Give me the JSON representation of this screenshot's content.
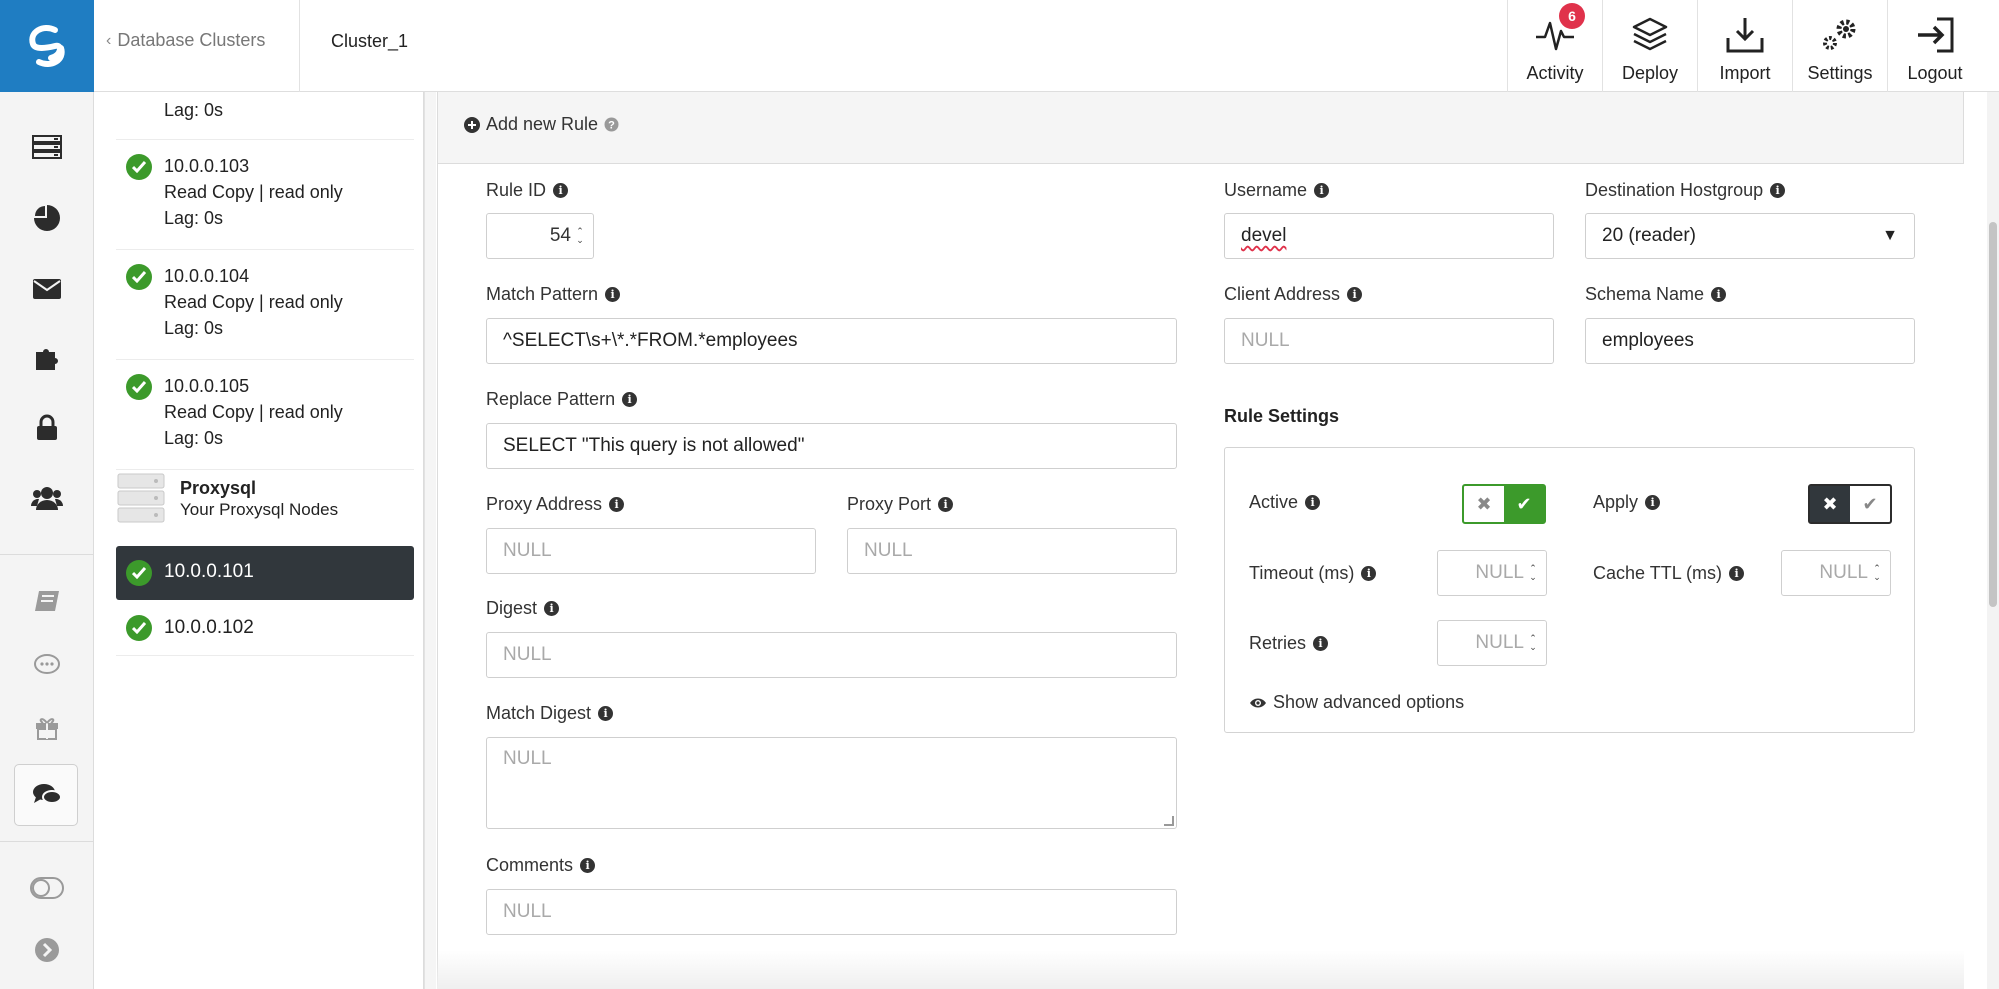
{
  "breadcrumb": {
    "back_label": "Database Clusters",
    "current": "Cluster_1"
  },
  "top_nav": [
    {
      "label": "Activity",
      "icon": "activity-icon",
      "badge": "6"
    },
    {
      "label": "Deploy",
      "icon": "deploy-icon"
    },
    {
      "label": "Import",
      "icon": "import-icon"
    },
    {
      "label": "Settings",
      "icon": "settings-icon"
    },
    {
      "label": "Logout",
      "icon": "logout-icon"
    }
  ],
  "rail_icons": [
    "clusters-icon",
    "dashboards-icon",
    "alarms-icon",
    "integrations-icon",
    "security-icon",
    "users-icon",
    "docs-icon",
    "feedback-icon",
    "whats-new-icon",
    "chat-icon",
    "toggle-icon",
    "expand-icon"
  ],
  "nodes": {
    "partial": {
      "lag": "Lag: 0s"
    },
    "list": [
      {
        "ip": "10.0.0.103",
        "role": "Read Copy | read only",
        "lag": "Lag: 0s"
      },
      {
        "ip": "10.0.0.104",
        "role": "Read Copy | read only",
        "lag": "Lag: 0s"
      },
      {
        "ip": "10.0.0.105",
        "role": "Read Copy | read only",
        "lag": "Lag: 0s"
      }
    ],
    "proxysql": {
      "title": "Proxysql",
      "subtitle": "Your Proxysql Nodes"
    },
    "proxysql_nodes": [
      {
        "ip": "10.0.0.101",
        "selected": true
      },
      {
        "ip": "10.0.0.102",
        "selected": false
      }
    ]
  },
  "form": {
    "add_rule_label": "Add new Rule",
    "rule_id": {
      "label": "Rule ID",
      "value": "54"
    },
    "match_pattern": {
      "label": "Match Pattern",
      "value": "^SELECT\\s+\\*.*FROM.*employees"
    },
    "replace_pattern": {
      "label": "Replace Pattern",
      "value": "SELECT \"This query is not allowed\""
    },
    "proxy_address": {
      "label": "Proxy Address",
      "placeholder": "NULL"
    },
    "proxy_port": {
      "label": "Proxy Port",
      "placeholder": "NULL"
    },
    "digest": {
      "label": "Digest",
      "placeholder": "NULL"
    },
    "match_digest": {
      "label": "Match Digest",
      "placeholder": "NULL"
    },
    "comments": {
      "label": "Comments",
      "placeholder": "NULL"
    },
    "username": {
      "label": "Username",
      "value": "devel"
    },
    "destination_hostgroup": {
      "label": "Destination Hostgroup",
      "value": "20 (reader)"
    },
    "client_address": {
      "label": "Client Address",
      "placeholder": "NULL"
    },
    "schema_name": {
      "label": "Schema Name",
      "value": "employees"
    }
  },
  "rule_settings": {
    "title": "Rule Settings",
    "active": {
      "label": "Active",
      "on": true
    },
    "apply": {
      "label": "Apply",
      "on": false
    },
    "timeout": {
      "label": "Timeout (ms)",
      "placeholder": "NULL"
    },
    "cache_ttl": {
      "label": "Cache TTL (ms)",
      "placeholder": "NULL"
    },
    "retries": {
      "label": "Retries",
      "placeholder": "NULL"
    },
    "show_advanced": "Show advanced options"
  },
  "colors": {
    "brand": "#1f7dc2",
    "ok": "#3c9a2b",
    "badge": "#e0324b",
    "selected": "#31373c"
  }
}
